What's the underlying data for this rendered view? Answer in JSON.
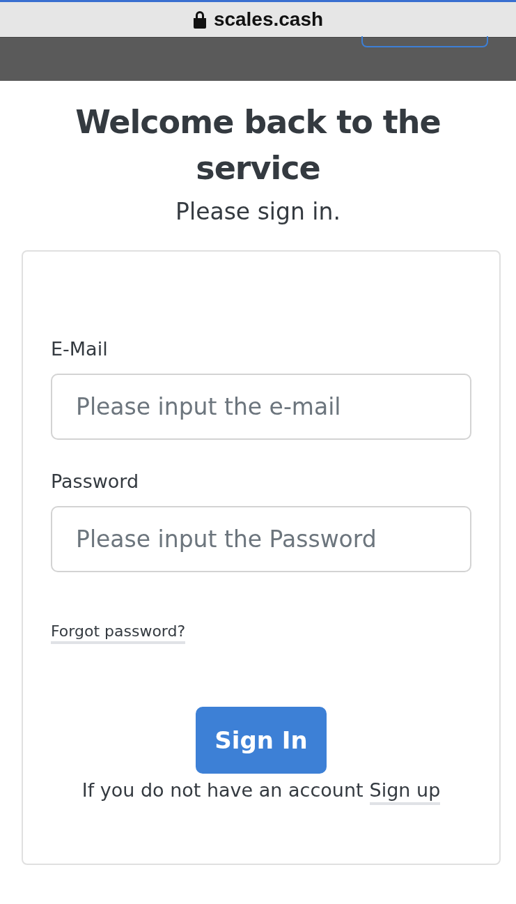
{
  "browser": {
    "url": "scales.cash"
  },
  "title": "Welcome back to the service",
  "subtitle": "Please sign in.",
  "form": {
    "fields": [
      {
        "label": "E-Mail",
        "placeholder": "Please input the e-mail"
      },
      {
        "label": "Password",
        "placeholder": "Please input the Password"
      }
    ],
    "forgot_link": "Forgot password?",
    "submit": "Sign In",
    "signup_prompt": "If you do not have an account",
    "signup_link": "Sign up"
  }
}
